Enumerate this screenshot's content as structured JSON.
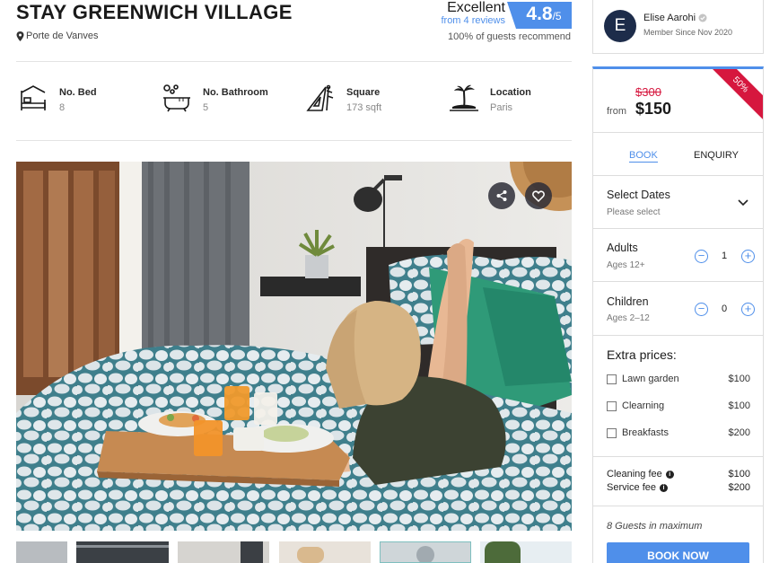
{
  "listing": {
    "title": "STAY GREENWICH VILLAGE",
    "location": "Porte de Vanves",
    "rating_word": "Excellent",
    "reviews": "from 4 reviews",
    "score": "4.8",
    "score_max": "/5",
    "recommend": "100% of guests recommend"
  },
  "features": [
    {
      "label": "No. Bed",
      "value": "8",
      "icon": "bed-icon"
    },
    {
      "label": "No. Bathroom",
      "value": "5",
      "icon": "bathtub-icon"
    },
    {
      "label": "Square",
      "value": "173 sqft",
      "icon": "drafting-tools-icon"
    },
    {
      "label": "Location",
      "value": "Paris",
      "icon": "island-icon"
    }
  ],
  "host": {
    "initial": "E",
    "name": "Elise Aarohi",
    "since": "Member Since Nov 2020"
  },
  "booking": {
    "discount": "50%",
    "old_price": "$300",
    "from": "from",
    "price": "$150",
    "tabs": [
      "BOOK",
      "ENQUIRY"
    ],
    "dates_label": "Select Dates",
    "dates_placeholder": "Please select",
    "adults_label": "Adults",
    "adults_sub": "Ages 12+",
    "adults_value": "1",
    "children_label": "Children",
    "children_sub": "Ages 2–12",
    "children_value": "0",
    "extra_title": "Extra prices:",
    "extras": [
      {
        "name": "Lawn garden",
        "price": "$100"
      },
      {
        "name": "Clearning",
        "price": "$100"
      },
      {
        "name": "Breakfasts",
        "price": "$200"
      }
    ],
    "fees": [
      {
        "name": "Cleaning fee",
        "price": "$100"
      },
      {
        "name": "Service fee",
        "price": "$200"
      }
    ],
    "max_guests": "8 Guests in maximum",
    "book_now": "BOOK NOW"
  },
  "colors": {
    "accent": "#4f8fea",
    "ribbon": "#d6173e",
    "avatar_bg": "#1d2c4a"
  }
}
